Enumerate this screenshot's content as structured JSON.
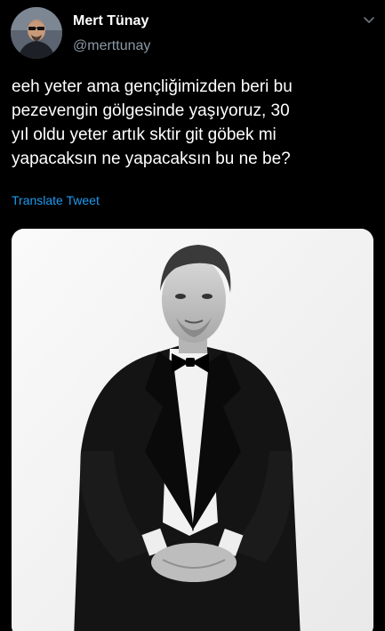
{
  "author": {
    "display_name": "Mert Tünay",
    "handle": "@merttunay"
  },
  "tweet": {
    "lines": [
      "eeh yeter ama gençliğimizden beri bu",
      "pezevengin gölgesinde yaşıyoruz, 30",
      "yıl oldu yeter artık sktir git göbek mi",
      "yapacaksın ne yapacaksın bu ne be?"
    ],
    "translate_label": "Translate Tweet"
  },
  "icons": {
    "menu": "chevron-down-icon",
    "avatar": "avatar-image"
  },
  "colors": {
    "background": "#000000",
    "text": "#ffffff",
    "secondary_text": "#8b98a5",
    "link": "#1d9bf0"
  }
}
